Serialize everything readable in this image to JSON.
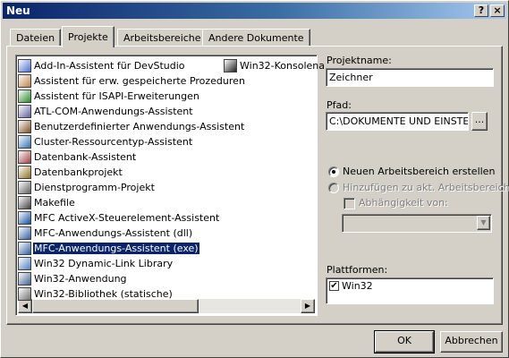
{
  "window": {
    "title": "Neu",
    "help_btn": "?",
    "close_btn": "×"
  },
  "tabs": [
    "Dateien",
    "Projekte",
    "Arbeitsbereiche",
    "Andere Dokumente"
  ],
  "active_tab": "Projekte",
  "project_types": [
    "Add-In-Assistent für DevStudio",
    "Assistent für erw. gespeicherte Prozeduren",
    "Assistent für ISAPI-Erweiterungen",
    "ATL-COM-Anwendungs-Assistent",
    "Benutzerdefinierter Anwendungs-Assistent",
    "Cluster-Ressourcentyp-Assistent",
    "Datenbank-Assistent",
    "Datenbankprojekt",
    "Dienstprogramm-Projekt",
    "Makefile",
    "MFC ActiveX-Steuerelement-Assistent",
    "MFC-Anwendungs-Assistent (dll)",
    "MFC-Anwendungs-Assistent (exe)",
    "Win32 Dynamic-Link Library",
    "Win32-Anwendung",
    "Win32-Bibliothek (statische)",
    "Win32-Konsolena"
  ],
  "selected_project_type": "MFC-Anwendungs-Assistent (exe)",
  "icons": [
    "wizard-icon",
    "procedure-icon",
    "globe-icon",
    "atl-icon",
    "custom-wizard-icon",
    "cluster-icon",
    "database-wizard-icon",
    "database-icon",
    "utility-icon",
    "makefile-icon",
    "activex-icon",
    "mfc-dll-icon",
    "mfc-exe-icon",
    "dll-icon",
    "win32-app-icon",
    "library-icon",
    "console-icon"
  ],
  "form": {
    "project_name_label": "Projektname:",
    "project_name_value": "Zeichner",
    "path_label": "Pfad:",
    "path_value": "C:\\DOKUMENTE UND EINSTE",
    "browse_label": "...",
    "radio_new_label": "Neuen Arbeitsbereich erstellen",
    "radio_add_label": "Hinzufügen zu akt. Arbeitsbereich",
    "dependency_label": "Abhängigkeit von:",
    "platforms_label": "Plattformen:",
    "platform_item": "Win32"
  },
  "buttons": {
    "ok": "OK",
    "cancel": "Abbrechen"
  },
  "colors": {
    "face": "#d4d0c8",
    "title_start": "#0a246a",
    "title_end": "#a6caf0",
    "selection": "#0a246a"
  }
}
